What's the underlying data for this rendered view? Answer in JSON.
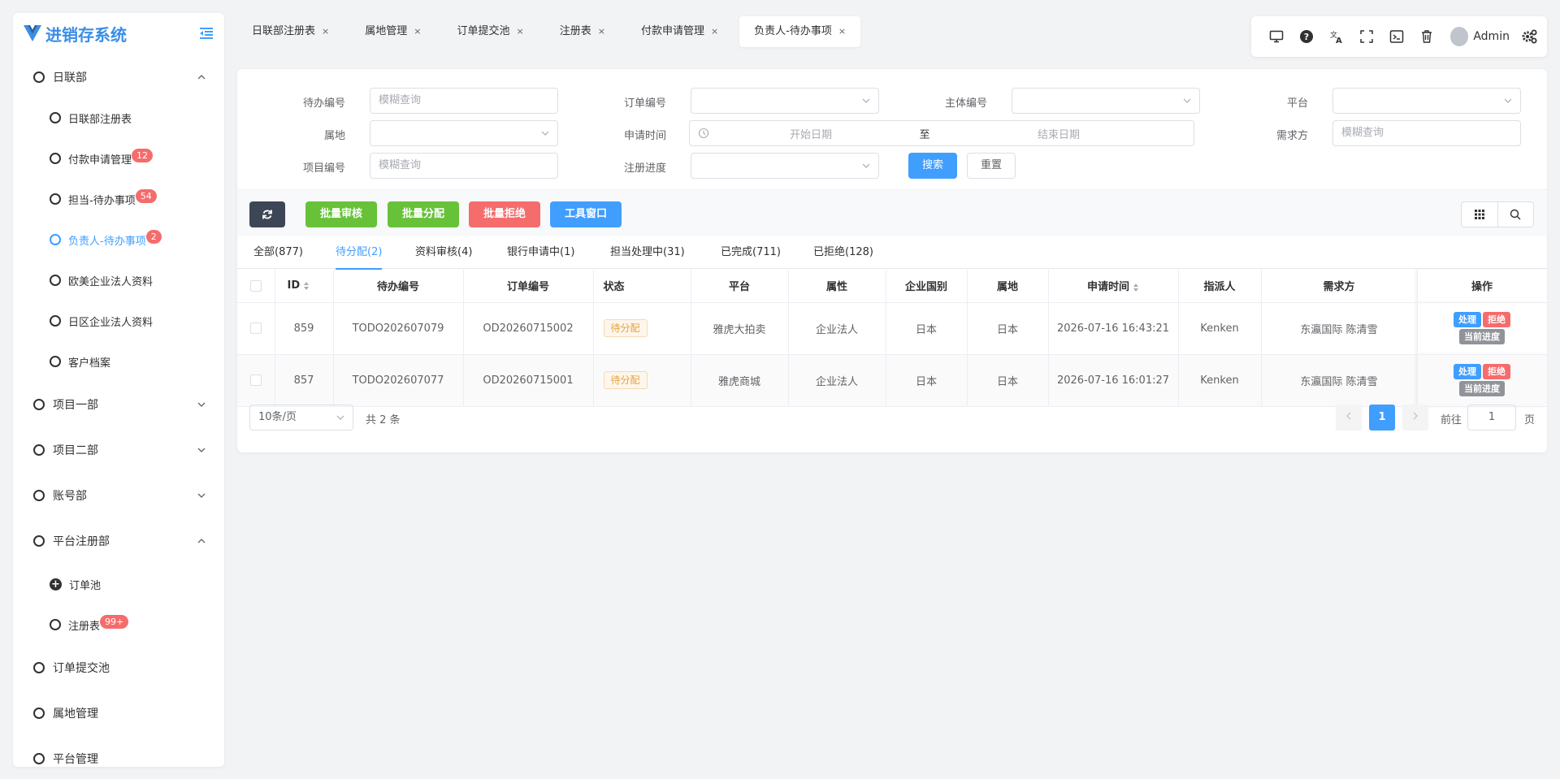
{
  "app": {
    "title": "进销存系统"
  },
  "sidebar": {
    "dept1": {
      "label": "日联部"
    },
    "dept1_items": [
      {
        "label": "日联部注册表",
        "badge": ""
      },
      {
        "label": "付款申请管理",
        "badge": "12"
      },
      {
        "label": "担当-待办事项",
        "badge": "54"
      },
      {
        "label": "负责人-待办事项",
        "badge": "2"
      },
      {
        "label": "欧美企业法人资料",
        "badge": ""
      },
      {
        "label": "日区企业法人资料",
        "badge": ""
      },
      {
        "label": "客户档案",
        "badge": ""
      }
    ],
    "dept2": {
      "label": "项目一部"
    },
    "dept3": {
      "label": "项目二部"
    },
    "dept4": {
      "label": "账号部"
    },
    "dept5": {
      "label": "平台注册部"
    },
    "dept5_items": [
      {
        "label": "订单池",
        "badge": ""
      },
      {
        "label": "注册表",
        "badge": "99+"
      }
    ],
    "item6": {
      "label": "订单提交池"
    },
    "item7": {
      "label": "属地管理"
    },
    "item8": {
      "label": "平台管理"
    }
  },
  "tabs": [
    {
      "label": "日联部注册表"
    },
    {
      "label": "属地管理"
    },
    {
      "label": "订单提交池"
    },
    {
      "label": "注册表"
    },
    {
      "label": "付款申请管理"
    },
    {
      "label": "负责人-待办事项"
    }
  ],
  "tab_close": "×",
  "toolbar": {
    "user": "Admin",
    "icons": [
      "monitor-icon",
      "help-icon",
      "translate-icon",
      "fullscreen-icon",
      "terminal-icon",
      "trash-icon",
      "settings-icon"
    ]
  },
  "filters": {
    "todo_no": {
      "label": "待办编号",
      "placeholder": "模糊查询"
    },
    "order_no": {
      "label": "订单编号"
    },
    "entity_no": {
      "label": "主体编号"
    },
    "platform": {
      "label": "平台"
    },
    "region": {
      "label": "属地"
    },
    "apply_time": {
      "label": "申请时间",
      "start": "开始日期",
      "sep": "至",
      "end": "结束日期"
    },
    "demander": {
      "label": "需求方",
      "placeholder": "模糊查询"
    },
    "project_no": {
      "label": "项目编号",
      "placeholder": "模糊查询"
    },
    "reg_progress": {
      "label": "注册进度"
    },
    "search": "搜索",
    "reset": "重置"
  },
  "actions": {
    "batch_review": "批量审核",
    "batch_assign": "批量分配",
    "batch_reject": "批量拒绝",
    "tool_window": "工具窗口"
  },
  "status_tabs": [
    {
      "label": "全部(877)"
    },
    {
      "label": "待分配(2)"
    },
    {
      "label": "资料审核(4)"
    },
    {
      "label": "银行申请中(1)"
    },
    {
      "label": "担当处理中(31)"
    },
    {
      "label": "已完成(711)"
    },
    {
      "label": "已拒绝(128)"
    }
  ],
  "table": {
    "headers": [
      "ID",
      "待办编号",
      "订单编号",
      "状态",
      "平台",
      "属性",
      "企业国别",
      "属地",
      "申请时间",
      "指派人",
      "需求方",
      "操作"
    ],
    "rows": [
      {
        "id": "859",
        "todo": "TODO202607079",
        "order": "OD20260715002",
        "status": "待分配",
        "platform": "雅虎大拍卖",
        "attr": "企业法人",
        "country": "日本",
        "region": "日本",
        "time": "2026-07-16 16:43:21",
        "assignee": "Kenken",
        "demander": "东瀛国际 陈清雪"
      },
      {
        "id": "857",
        "todo": "TODO202607077",
        "order": "OD20260715001",
        "status": "待分配",
        "platform": "雅虎商城",
        "attr": "企业法人",
        "country": "日本",
        "region": "日本",
        "time": "2026-07-16 16:01:27",
        "assignee": "Kenken",
        "demander": "东瀛国际 陈清雪"
      }
    ],
    "ops": {
      "process": "处理",
      "reject": "拒绝",
      "progress": "当前进度"
    }
  },
  "pagination": {
    "page_size": "10条/页",
    "total": "共 2 条",
    "current": "1",
    "goto_label": "前往",
    "goto_value": "1",
    "page_unit": "页"
  },
  "colors": {
    "primary": "#409eff",
    "success": "#67c23a",
    "danger": "#f56c6c",
    "dark": "#3c4656",
    "warning": "#e6a23c"
  }
}
